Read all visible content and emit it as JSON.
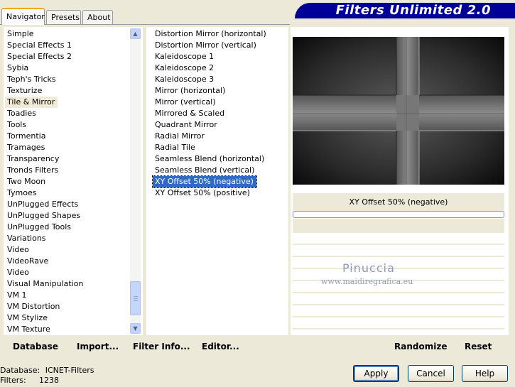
{
  "window": {
    "banner": "Filters Unlimited 2.0"
  },
  "tabs": [
    {
      "label": "Navigator",
      "active": true
    },
    {
      "label": "Presets",
      "active": false
    },
    {
      "label": "About",
      "active": false
    }
  ],
  "categories": [
    "Simple",
    "Special Effects 1",
    "Special Effects 2",
    "Sybia",
    "Teph's Tricks",
    "Texturize",
    "Tile & Mirror",
    "Toadies",
    "Tools",
    "Tormentia",
    "Tramages",
    "Transparency",
    "Tronds Filters",
    "Two Moon",
    "Tymoes",
    "UnPlugged Effects",
    "UnPlugged Shapes",
    "UnPlugged Tools",
    "Variations",
    "Video",
    "VideoRave",
    "Video",
    "Visual Manipulation",
    "VM 1",
    "VM Distortion",
    "VM Stylize",
    "VM Texture"
  ],
  "selected_category": "Tile & Mirror",
  "filters": [
    "Distortion Mirror (horizontal)",
    "Distortion Mirror (vertical)",
    "Kaleidoscope 1",
    "Kaleidoscope 2",
    "Kaleidoscope 3",
    "Mirror (horizontal)",
    "Mirror (vertical)",
    "Mirrored & Scaled",
    "Quadrant Mirror",
    "Radial Mirror",
    "Radial Tile",
    "Seamless Blend (horizontal)",
    "Seamless Blend (vertical)",
    "XY Offset 50% (negative)",
    "XY Offset 50% (positive)"
  ],
  "selected_filter": "XY Offset 50% (negative)",
  "preview": {
    "caption": "XY Offset 50% (negative)"
  },
  "watermark": {
    "line1": "Pinuccia",
    "line2": "www.maidiregrafica.eu"
  },
  "toolbar": {
    "database": "Database",
    "import": "Import...",
    "filter_info": "Filter Info...",
    "editor": "Editor...",
    "randomize": "Randomize",
    "reset": "Reset"
  },
  "buttons": {
    "apply": "Apply",
    "cancel": "Cancel",
    "help": "Help"
  },
  "status": {
    "database_label": "Database:",
    "database_value": "ICNET-Filters",
    "filters_label": "Filters:",
    "filters_value": "1238"
  },
  "colors": {
    "banner": "#000099",
    "selection": "#316ac5",
    "face": "#ece9d8"
  }
}
